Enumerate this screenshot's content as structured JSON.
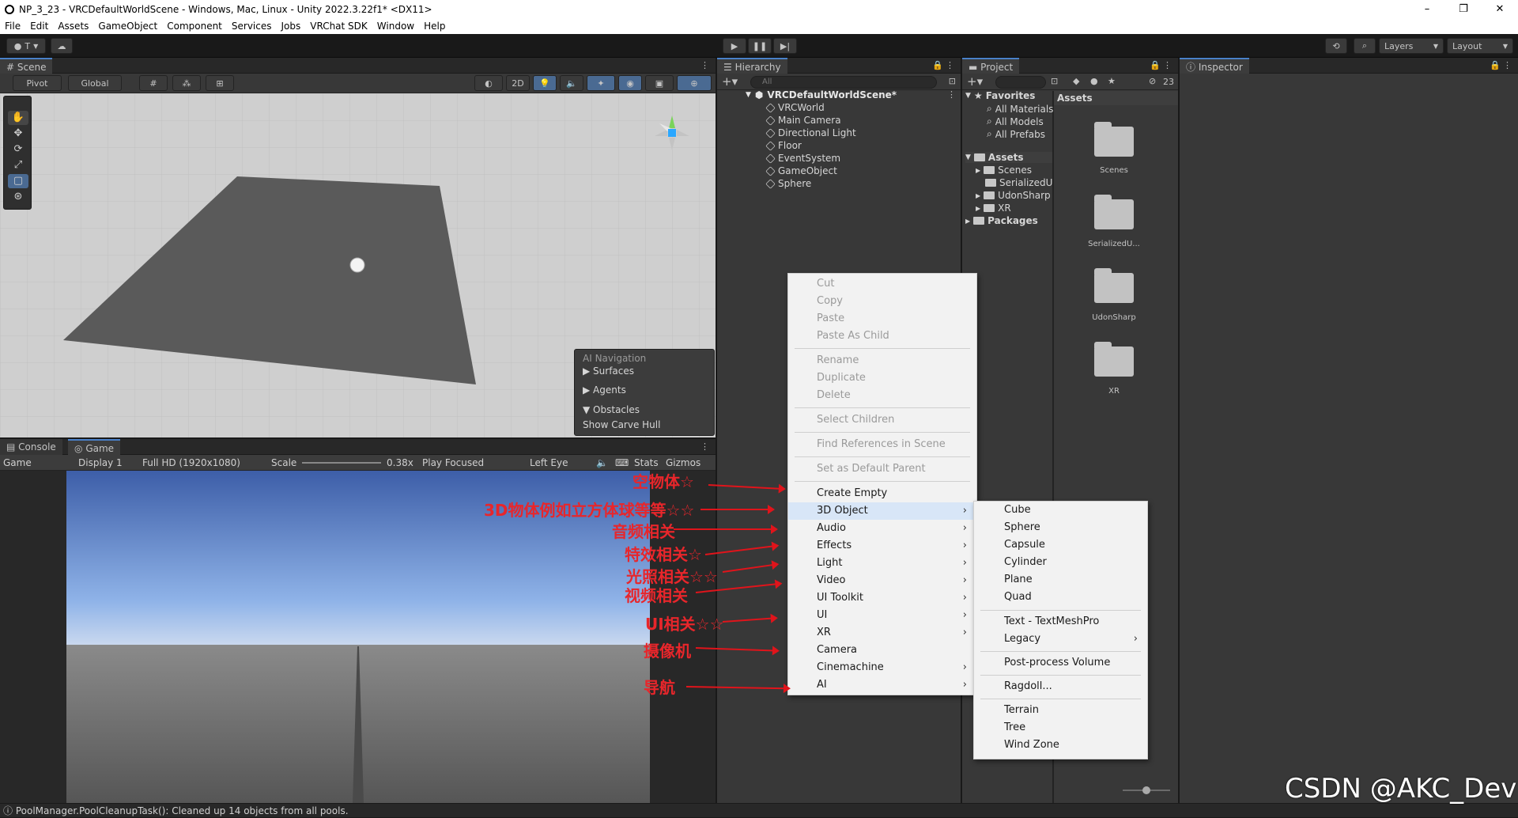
{
  "window": {
    "title": "NP_3_23 - VRCDefaultWorldScene - Windows, Mac, Linux - Unity 2022.3.22f1* <DX11>",
    "controls": [
      "–",
      "❐",
      "✕"
    ]
  },
  "menubar": [
    "File",
    "Edit",
    "Assets",
    "GameObject",
    "Component",
    "Services",
    "Jobs",
    "VRChat SDK",
    "Window",
    "Help"
  ],
  "toolbar": {
    "account": "T",
    "layers": "Layers",
    "layout": "Layout"
  },
  "scene": {
    "tab": "Scene",
    "pivot": "Pivot",
    "global": "Global",
    "mode_2d": "2D",
    "ai_navigation": {
      "title": "AI Navigation",
      "items": [
        "Surfaces",
        "Agents",
        "Obstacles",
        "Show Carve Hull"
      ]
    }
  },
  "game": {
    "tabs": [
      "Console",
      "Game"
    ],
    "bar": {
      "mode": "Game",
      "display": "Display 1",
      "resolution": "Full HD (1920x1080)",
      "scale_label": "Scale",
      "scale_value": "0.38x",
      "play_mode": "Play Focused",
      "eye": "Left Eye",
      "stats": "Stats",
      "gizmos": "Gizmos"
    }
  },
  "hierarchy": {
    "tab": "Hierarchy",
    "search_placeholder": "All",
    "scene_name": "VRCDefaultWorldScene*",
    "items": [
      "VRCWorld",
      "Main Camera",
      "Directional Light",
      "Floor",
      "EventSystem",
      "GameObject",
      "Sphere"
    ]
  },
  "project": {
    "tab": "Project",
    "count": "23",
    "favorites_label": "Favorites",
    "favorites": [
      "All Materials",
      "All Models",
      "All Prefabs"
    ],
    "assets_label": "Assets",
    "asset_folders": [
      "Scenes",
      "SerializedU",
      "UdonSharp",
      "XR"
    ],
    "packages_label": "Packages",
    "grid_header": "Assets",
    "grid": [
      "Scenes",
      "SerializedU...",
      "UdonSharp",
      "XR"
    ]
  },
  "inspector": {
    "tab": "Inspector"
  },
  "context_menu": {
    "disabled_group1": [
      "Cut",
      "Copy",
      "Paste",
      "Paste As Child"
    ],
    "disabled_group2": [
      "Rename",
      "Duplicate",
      "Delete"
    ],
    "disabled_group3": [
      "Select Children"
    ],
    "disabled_group4": [
      "Find References in Scene"
    ],
    "disabled_group5": [
      "Set as Default Parent"
    ],
    "enabled": [
      "Create Empty",
      "3D Object",
      "Audio",
      "Effects",
      "Light",
      "Video",
      "UI Toolkit",
      "UI",
      "XR",
      "Camera",
      "Cinemachine",
      "AI"
    ],
    "arrow": "›"
  },
  "submenu_3d": {
    "group1": [
      "Cube",
      "Sphere",
      "Capsule",
      "Cylinder",
      "Plane",
      "Quad"
    ],
    "group2": [
      "Text - TextMeshPro",
      "Legacy"
    ],
    "group3": [
      "Post-process Volume"
    ],
    "group4": [
      "Ragdoll..."
    ],
    "group5": [
      "Terrain",
      "Tree",
      "Wind Zone"
    ]
  },
  "annotations": [
    "空物体☆",
    "3D物体例如立方体球等等☆☆",
    "音频相关",
    "特效相关☆",
    "光照相关☆☆",
    "视频相关",
    "UI相关☆☆",
    "摄像机",
    "导航"
  ],
  "status": {
    "message": "PoolManager.PoolCleanupTask(): Cleaned up 14 objects from all pools."
  },
  "watermark": "CSDN @AKC_Dev",
  "colors": {
    "annotation": "#e8262b",
    "accent": "#4a80c8"
  }
}
